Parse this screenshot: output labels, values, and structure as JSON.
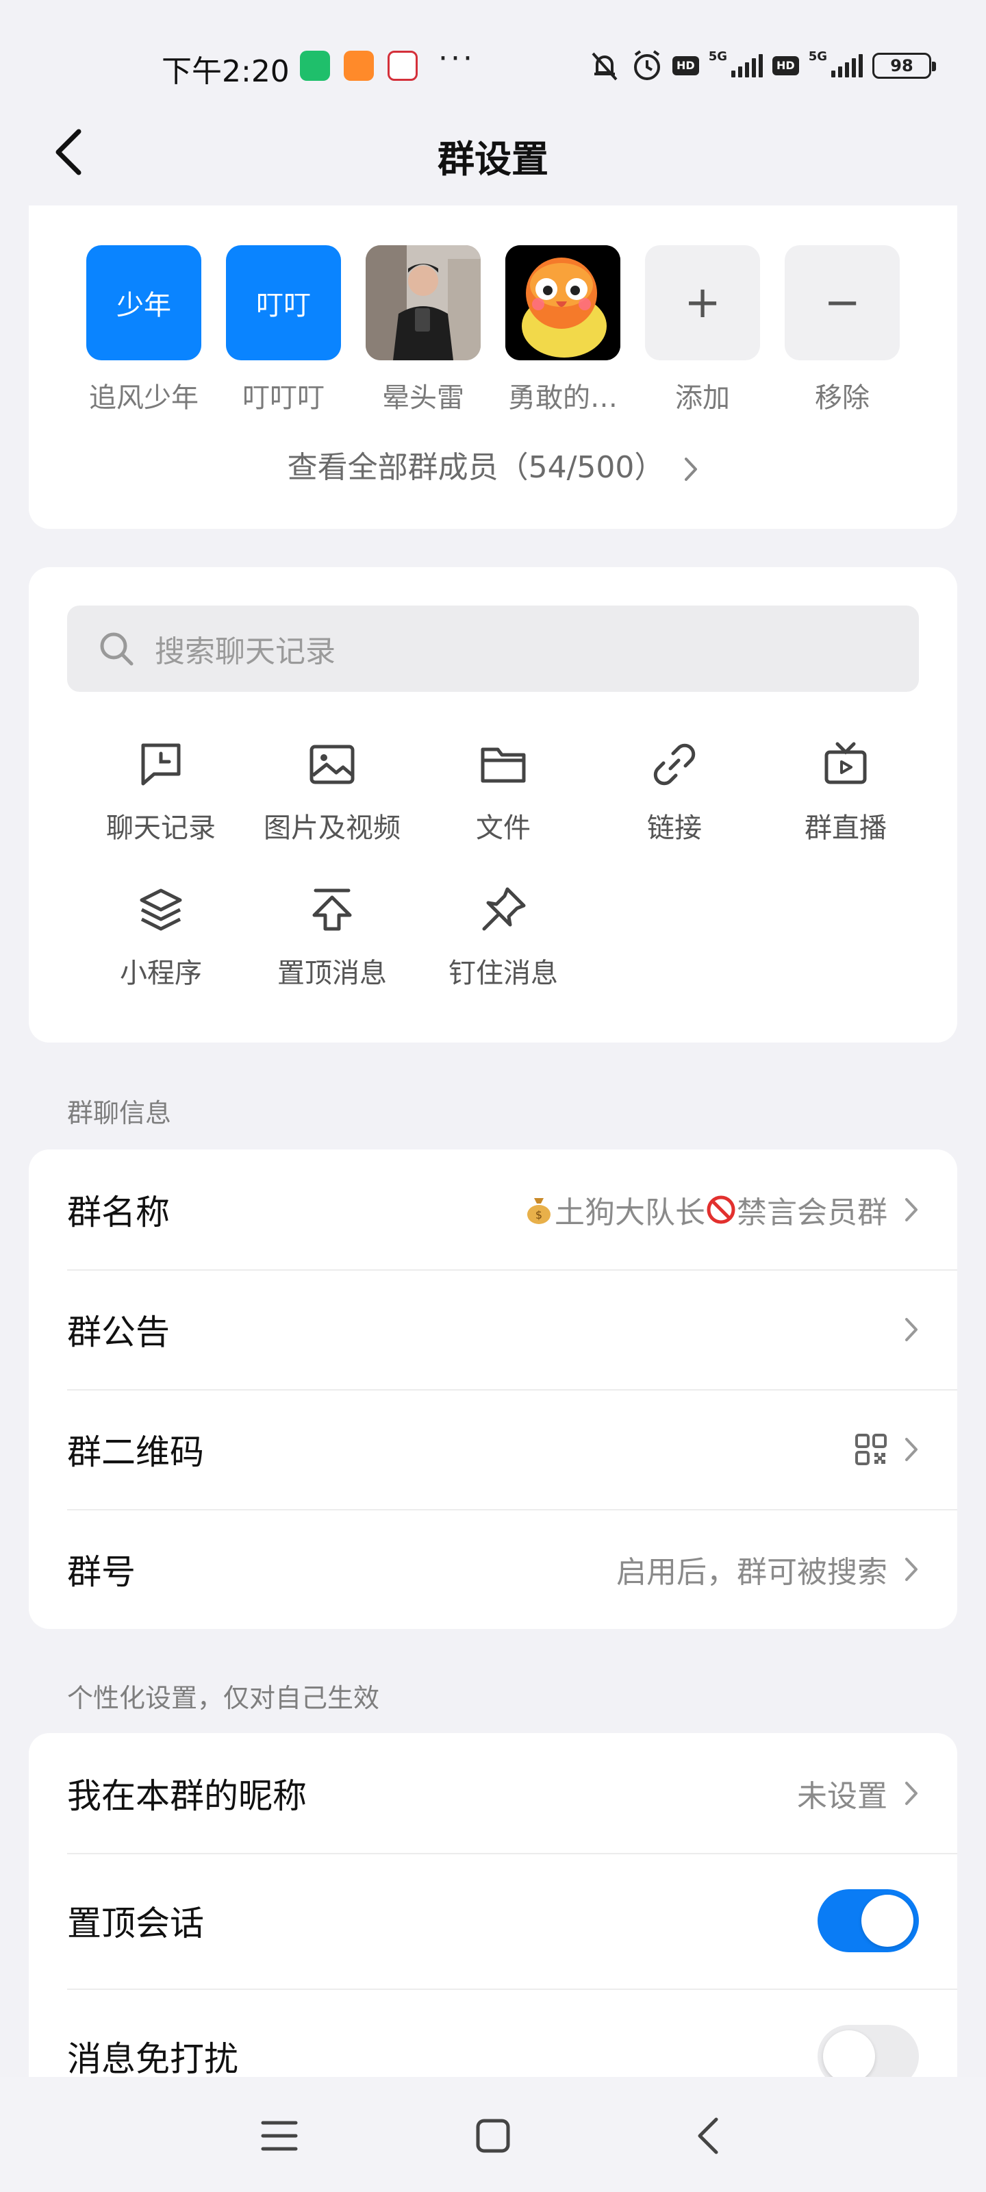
{
  "status_bar": {
    "time": "下午2:20",
    "more": "···",
    "net1": "5G",
    "net2": "5G",
    "hd": "HD",
    "battery": "98"
  },
  "header": {
    "title": "群设置"
  },
  "members": {
    "items": [
      {
        "name": "追风少年",
        "avatar_text": "少年",
        "type": "text"
      },
      {
        "name": "叮叮叮",
        "avatar_text": "叮叮",
        "type": "text"
      },
      {
        "name": "晕头雷",
        "avatar_text": "",
        "type": "photo"
      },
      {
        "name": "勇敢的…",
        "avatar_text": "",
        "type": "bird"
      }
    ],
    "add_label": "添加",
    "add_symbol": "+",
    "remove_label": "移除",
    "remove_symbol": "−",
    "view_all": "查看全部群成员（54/500）"
  },
  "tools": {
    "search_placeholder": "搜索聊天记录",
    "items": [
      {
        "label": "聊天记录",
        "icon": "chat-history-icon"
      },
      {
        "label": "图片及视频",
        "icon": "image-icon"
      },
      {
        "label": "文件",
        "icon": "folder-icon"
      },
      {
        "label": "链接",
        "icon": "link-icon"
      },
      {
        "label": "群直播",
        "icon": "tv-icon"
      },
      {
        "label": "小程序",
        "icon": "layers-icon"
      },
      {
        "label": "置顶消息",
        "icon": "pin-top-icon"
      },
      {
        "label": "钉住消息",
        "icon": "pushpin-icon"
      }
    ]
  },
  "group_info": {
    "section_title": "群聊信息",
    "name_label": "群名称",
    "name_value": "土狗大队长",
    "name_value_2": "禁言会员群",
    "notice_label": "群公告",
    "qr_label": "群二维码",
    "id_label": "群号",
    "id_value": "启用后，群可被搜索"
  },
  "personal": {
    "section_title": "个性化设置，仅对自己生效",
    "nickname_label": "我在本群的昵称",
    "nickname_value": "未设置",
    "pin_label": "置顶会话",
    "pin_on": true,
    "mute_label": "消息免打扰",
    "mute_on": false
  },
  "colors": {
    "accent": "#0a84ff",
    "toggle_on": "#0a7cf5",
    "background": "#f2f2f6"
  }
}
